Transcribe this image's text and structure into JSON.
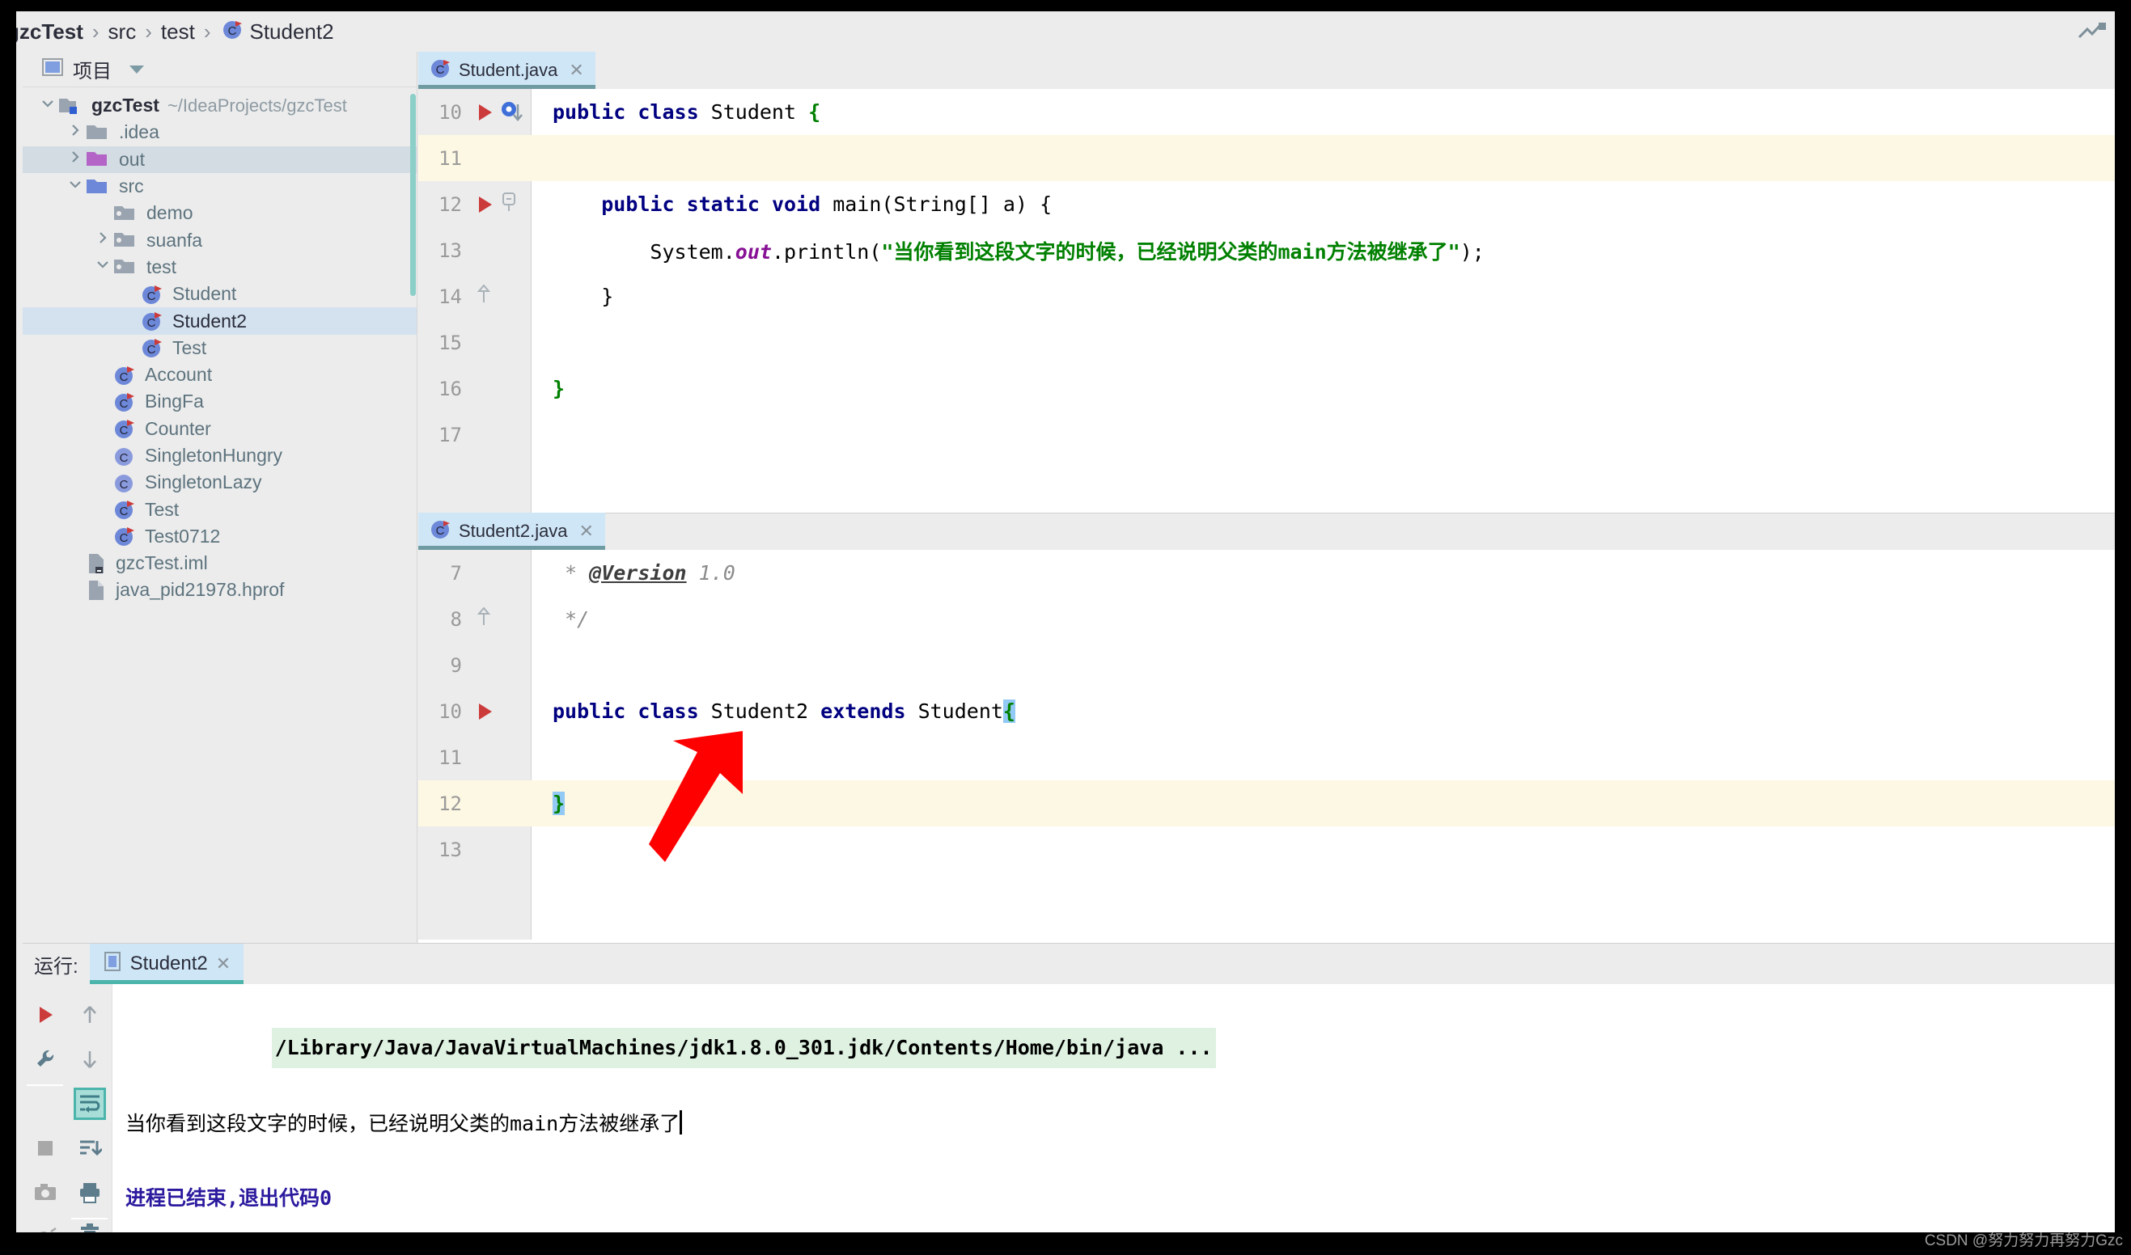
{
  "breadcrumb": {
    "items": [
      {
        "label": "gzcTest",
        "icon": "none",
        "bold": true
      },
      {
        "label": "src",
        "icon": "none",
        "bold": false
      },
      {
        "label": "test",
        "icon": "none",
        "bold": false
      },
      {
        "label": "Student2",
        "icon": "java-class-icon",
        "bold": false
      }
    ],
    "separator": "›"
  },
  "sidebar": {
    "title": "项目",
    "title_icon": "project-window-icon",
    "toolbar_icons": [
      "locate-icon",
      "expand-all-icon",
      "collapse-all-icon",
      "settings-gear-icon",
      "hide-icon"
    ],
    "tree": [
      {
        "label": "gzcTest",
        "path": "~/IdeaProjects/gzcTest",
        "indent": 0,
        "arrow": "down",
        "icon": "project-folder-icon",
        "state": "bold"
      },
      {
        "label": ".idea",
        "path": "",
        "indent": 1,
        "arrow": "right",
        "icon": "folder-gray-icon",
        "state": "normal"
      },
      {
        "label": "out",
        "path": "",
        "indent": 1,
        "arrow": "right",
        "icon": "folder-purple-icon",
        "state": "selected-gray"
      },
      {
        "label": "src",
        "path": "",
        "indent": 1,
        "arrow": "down",
        "icon": "folder-blue-icon",
        "state": "normal"
      },
      {
        "label": "demo",
        "path": "",
        "indent": 2,
        "arrow": "none",
        "icon": "package-icon",
        "state": "normal"
      },
      {
        "label": "suanfa",
        "path": "",
        "indent": 2,
        "arrow": "right",
        "icon": "package-icon",
        "state": "normal"
      },
      {
        "label": "test",
        "path": "",
        "indent": 2,
        "arrow": "down",
        "icon": "package-icon",
        "state": "normal"
      },
      {
        "label": "Student",
        "path": "",
        "indent": 3,
        "arrow": "none",
        "icon": "java-class-runnable-icon",
        "state": "normal"
      },
      {
        "label": "Student2",
        "path": "",
        "indent": 3,
        "arrow": "none",
        "icon": "java-class-runnable-icon",
        "state": "selected"
      },
      {
        "label": "Test",
        "path": "",
        "indent": 3,
        "arrow": "none",
        "icon": "java-class-runnable-icon",
        "state": "normal"
      },
      {
        "label": "Account",
        "path": "",
        "indent": 2,
        "arrow": "none",
        "icon": "java-class-runnable-icon",
        "state": "normal"
      },
      {
        "label": "BingFa",
        "path": "",
        "indent": 2,
        "arrow": "none",
        "icon": "java-class-runnable-icon",
        "state": "normal"
      },
      {
        "label": "Counter",
        "path": "",
        "indent": 2,
        "arrow": "none",
        "icon": "java-class-runnable-icon",
        "state": "normal"
      },
      {
        "label": "SingletonHungry",
        "path": "",
        "indent": 2,
        "arrow": "none",
        "icon": "java-class-icon",
        "state": "normal"
      },
      {
        "label": "SingletonLazy",
        "path": "",
        "indent": 2,
        "arrow": "none",
        "icon": "java-class-icon",
        "state": "normal"
      },
      {
        "label": "Test",
        "path": "",
        "indent": 2,
        "arrow": "none",
        "icon": "java-class-runnable-icon",
        "state": "normal"
      },
      {
        "label": "Test0712",
        "path": "",
        "indent": 2,
        "arrow": "none",
        "icon": "java-class-runnable-icon",
        "state": "normal"
      },
      {
        "label": "gzcTest.iml",
        "path": "",
        "indent": 1,
        "arrow": "none",
        "icon": "iml-file-icon",
        "state": "normal"
      },
      {
        "label": "java_pid21978.hprof",
        "path": "",
        "indent": 1,
        "arrow": "none",
        "icon": "hprof-file-icon",
        "state": "normal"
      }
    ]
  },
  "editor_top": {
    "tab": {
      "label": "Student.java",
      "icon": "java-class-runnable-icon",
      "close": "✕",
      "active": true
    },
    "lines": [
      {
        "num": "10",
        "gutter": [
          "run-triangle-icon",
          "overridden-method-icon"
        ],
        "fold": "none",
        "highlight": false,
        "tokens": [
          {
            "t": "public ",
            "c": "kw"
          },
          {
            "t": "class ",
            "c": "kw"
          },
          {
            "t": "Student ",
            "c": ""
          },
          {
            "t": "{",
            "c": "str"
          }
        ]
      },
      {
        "num": "11",
        "gutter": [],
        "fold": "none",
        "highlight": true,
        "tokens": []
      },
      {
        "num": "12",
        "gutter": [
          "run-triangle-icon"
        ],
        "fold": "collapse",
        "highlight": false,
        "tokens": [
          {
            "t": "    ",
            "c": ""
          },
          {
            "t": "public ",
            "c": "kw"
          },
          {
            "t": "static ",
            "c": "kw"
          },
          {
            "t": "void ",
            "c": "kw"
          },
          {
            "t": "main(String[] a) {",
            "c": ""
          }
        ]
      },
      {
        "num": "13",
        "gutter": [],
        "fold": "none",
        "highlight": false,
        "tokens": [
          {
            "t": "        System.",
            "c": ""
          },
          {
            "t": "out",
            "c": "fld"
          },
          {
            "t": ".println(",
            "c": ""
          },
          {
            "t": "\"当你看到这段文字的时候，已经说明父类的main方法被继承了\"",
            "c": "str"
          },
          {
            "t": ");",
            "c": ""
          }
        ]
      },
      {
        "num": "14",
        "gutter": [],
        "fold": "end",
        "highlight": false,
        "tokens": [
          {
            "t": "    }",
            "c": ""
          }
        ]
      },
      {
        "num": "15",
        "gutter": [],
        "fold": "none",
        "highlight": false,
        "tokens": []
      },
      {
        "num": "16",
        "gutter": [],
        "fold": "none",
        "highlight": false,
        "tokens": [
          {
            "t": "}",
            "c": "str"
          }
        ]
      },
      {
        "num": "17",
        "gutter": [],
        "fold": "none",
        "highlight": false,
        "tokens": []
      }
    ]
  },
  "editor_bottom": {
    "tab": {
      "label": "Student2.java",
      "icon": "java-class-runnable-icon",
      "close": "✕",
      "active": true
    },
    "lines": [
      {
        "num": "7",
        "gutter": [],
        "fold": "none",
        "highlight": false,
        "tokens": [
          {
            "t": " * ",
            "c": "cmt"
          },
          {
            "t": "@Version",
            "c": "tag"
          },
          {
            "t": " 1.0",
            "c": "cmt"
          }
        ]
      },
      {
        "num": "8",
        "gutter": [],
        "fold": "end",
        "highlight": false,
        "tokens": [
          {
            "t": " */",
            "c": "cmt"
          }
        ]
      },
      {
        "num": "9",
        "gutter": [],
        "fold": "none",
        "highlight": false,
        "tokens": []
      },
      {
        "num": "10",
        "gutter": [
          "run-triangle-icon"
        ],
        "fold": "none",
        "highlight": false,
        "tokens": [
          {
            "t": "public ",
            "c": "kw"
          },
          {
            "t": "class ",
            "c": "kw"
          },
          {
            "t": "Student2 ",
            "c": ""
          },
          {
            "t": "extends ",
            "c": "kw"
          },
          {
            "t": "Student",
            "c": ""
          },
          {
            "t": "{",
            "c": "str brace-hl"
          }
        ]
      },
      {
        "num": "11",
        "gutter": [],
        "fold": "none",
        "highlight": false,
        "tokens": []
      },
      {
        "num": "12",
        "gutter": [],
        "fold": "none",
        "highlight": true,
        "tokens": [
          {
            "t": "}",
            "c": "str brace-hl"
          }
        ]
      },
      {
        "num": "13",
        "gutter": [],
        "fold": "none",
        "highlight": false,
        "tokens": []
      }
    ]
  },
  "run_panel": {
    "label": "运行:",
    "tab": {
      "label": "Student2",
      "icon": "run-config-icon",
      "close": "✕"
    },
    "toolbar_icons": [
      "rerun-icon",
      "scroll-up-icon",
      "settings-wrench-icon",
      "scroll-down-icon",
      "stop-icon",
      "soft-wrap-icon",
      "camera-icon",
      "scroll-to-end-icon",
      "debug-icon",
      "print-icon",
      "trash-icon"
    ],
    "console": {
      "command": "/Library/Java/JavaVirtualMachines/jdk1.8.0_301.jdk/Contents/Home/bin/java ...",
      "output": "当你看到这段文字的时候，已经说明父类的main方法被继承了",
      "exit": "进程已结束,退出代码0"
    }
  },
  "watermark": "CSDN @努力努力再努力Gzc",
  "colors": {
    "accent_blue": "#6d88d8",
    "selection": "#d4e2f0",
    "highlight_row": "#fdf8e3",
    "string_green": "#008000",
    "keyword_navy": "#000080",
    "red_arrow": "#ff0000",
    "teal": "#4bb5ab"
  }
}
